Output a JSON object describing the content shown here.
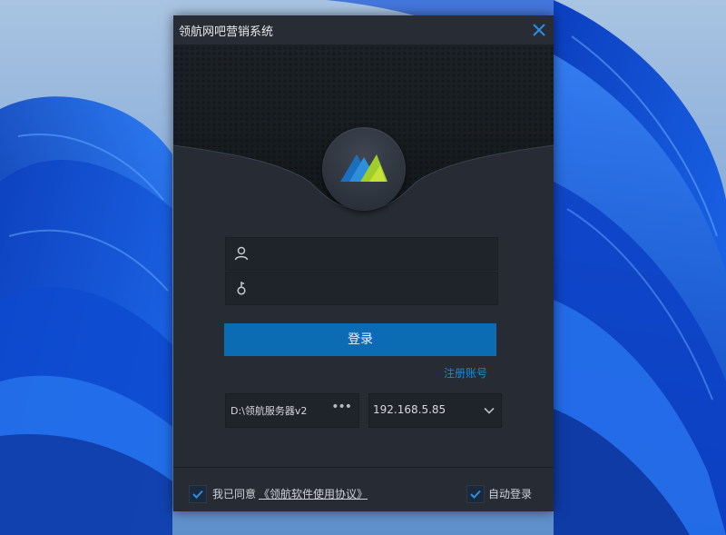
{
  "window": {
    "title": "领航网吧营销系统",
    "close_icon": "close-icon"
  },
  "login": {
    "username_value": "",
    "username_icon": "user-icon",
    "password_value": "",
    "password_icon": "key-icon",
    "button_label": "登录",
    "register_label": "注册账号"
  },
  "server": {
    "path_value": "D:\\领航服务器v2",
    "more_label": "•••",
    "ip_value": "192.168.5.85",
    "ip_dropdown_icon": "chevron-down-icon"
  },
  "footer": {
    "agree_text": "我已同意",
    "agreement_link": "《领航软件使用协议》",
    "agree_checked": true,
    "auto_login_label": "自动登录",
    "auto_login_checked": true
  },
  "colors": {
    "accent": "#0b6cb3",
    "link": "#1e88d4",
    "window_bg": "#262b34",
    "field_bg": "#1f232a"
  }
}
